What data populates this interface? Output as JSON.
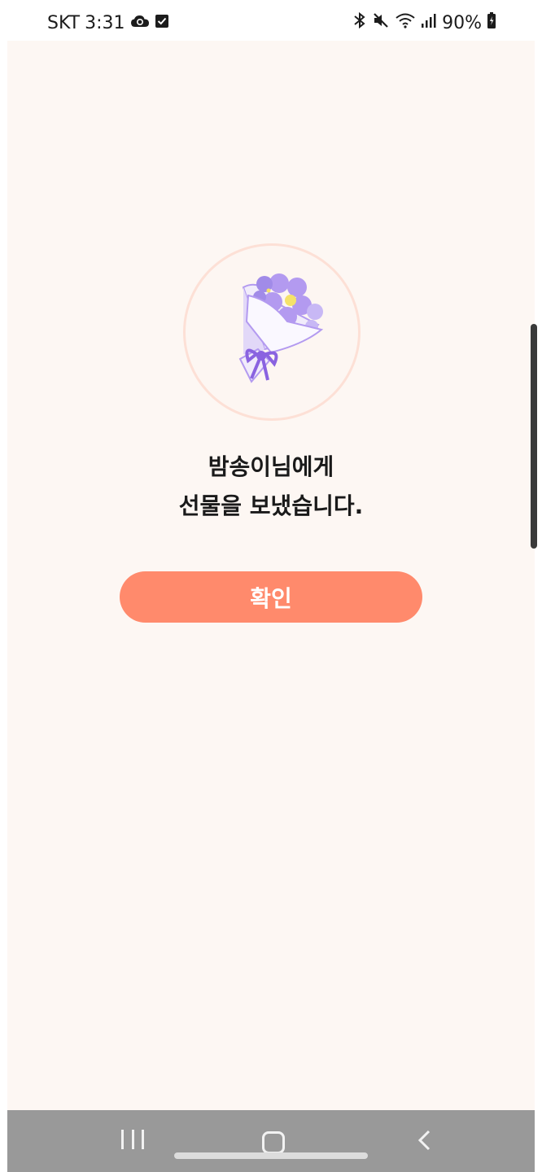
{
  "status_bar": {
    "carrier": "SKT",
    "time": "3:31",
    "battery": "90%",
    "icons": [
      "cloud-sync-icon",
      "checkbox-icon",
      "bluetooth-icon",
      "mute-icon",
      "wifi-icon",
      "signal-icon",
      "battery-icon"
    ]
  },
  "gift": {
    "illustration": "bouquet-icon",
    "message_line1": "밤송이님에게",
    "message_line2": "선물을 보냈습니다.",
    "confirm_label": "확인"
  },
  "colors": {
    "background": "#fdf7f3",
    "accent": "#ff8a6c",
    "circle_border": "#fde0d6",
    "flower": "#b39af0",
    "ribbon": "#8a63e0"
  },
  "nav_bar": {
    "buttons": [
      "recents-icon",
      "home-icon",
      "back-icon"
    ]
  }
}
